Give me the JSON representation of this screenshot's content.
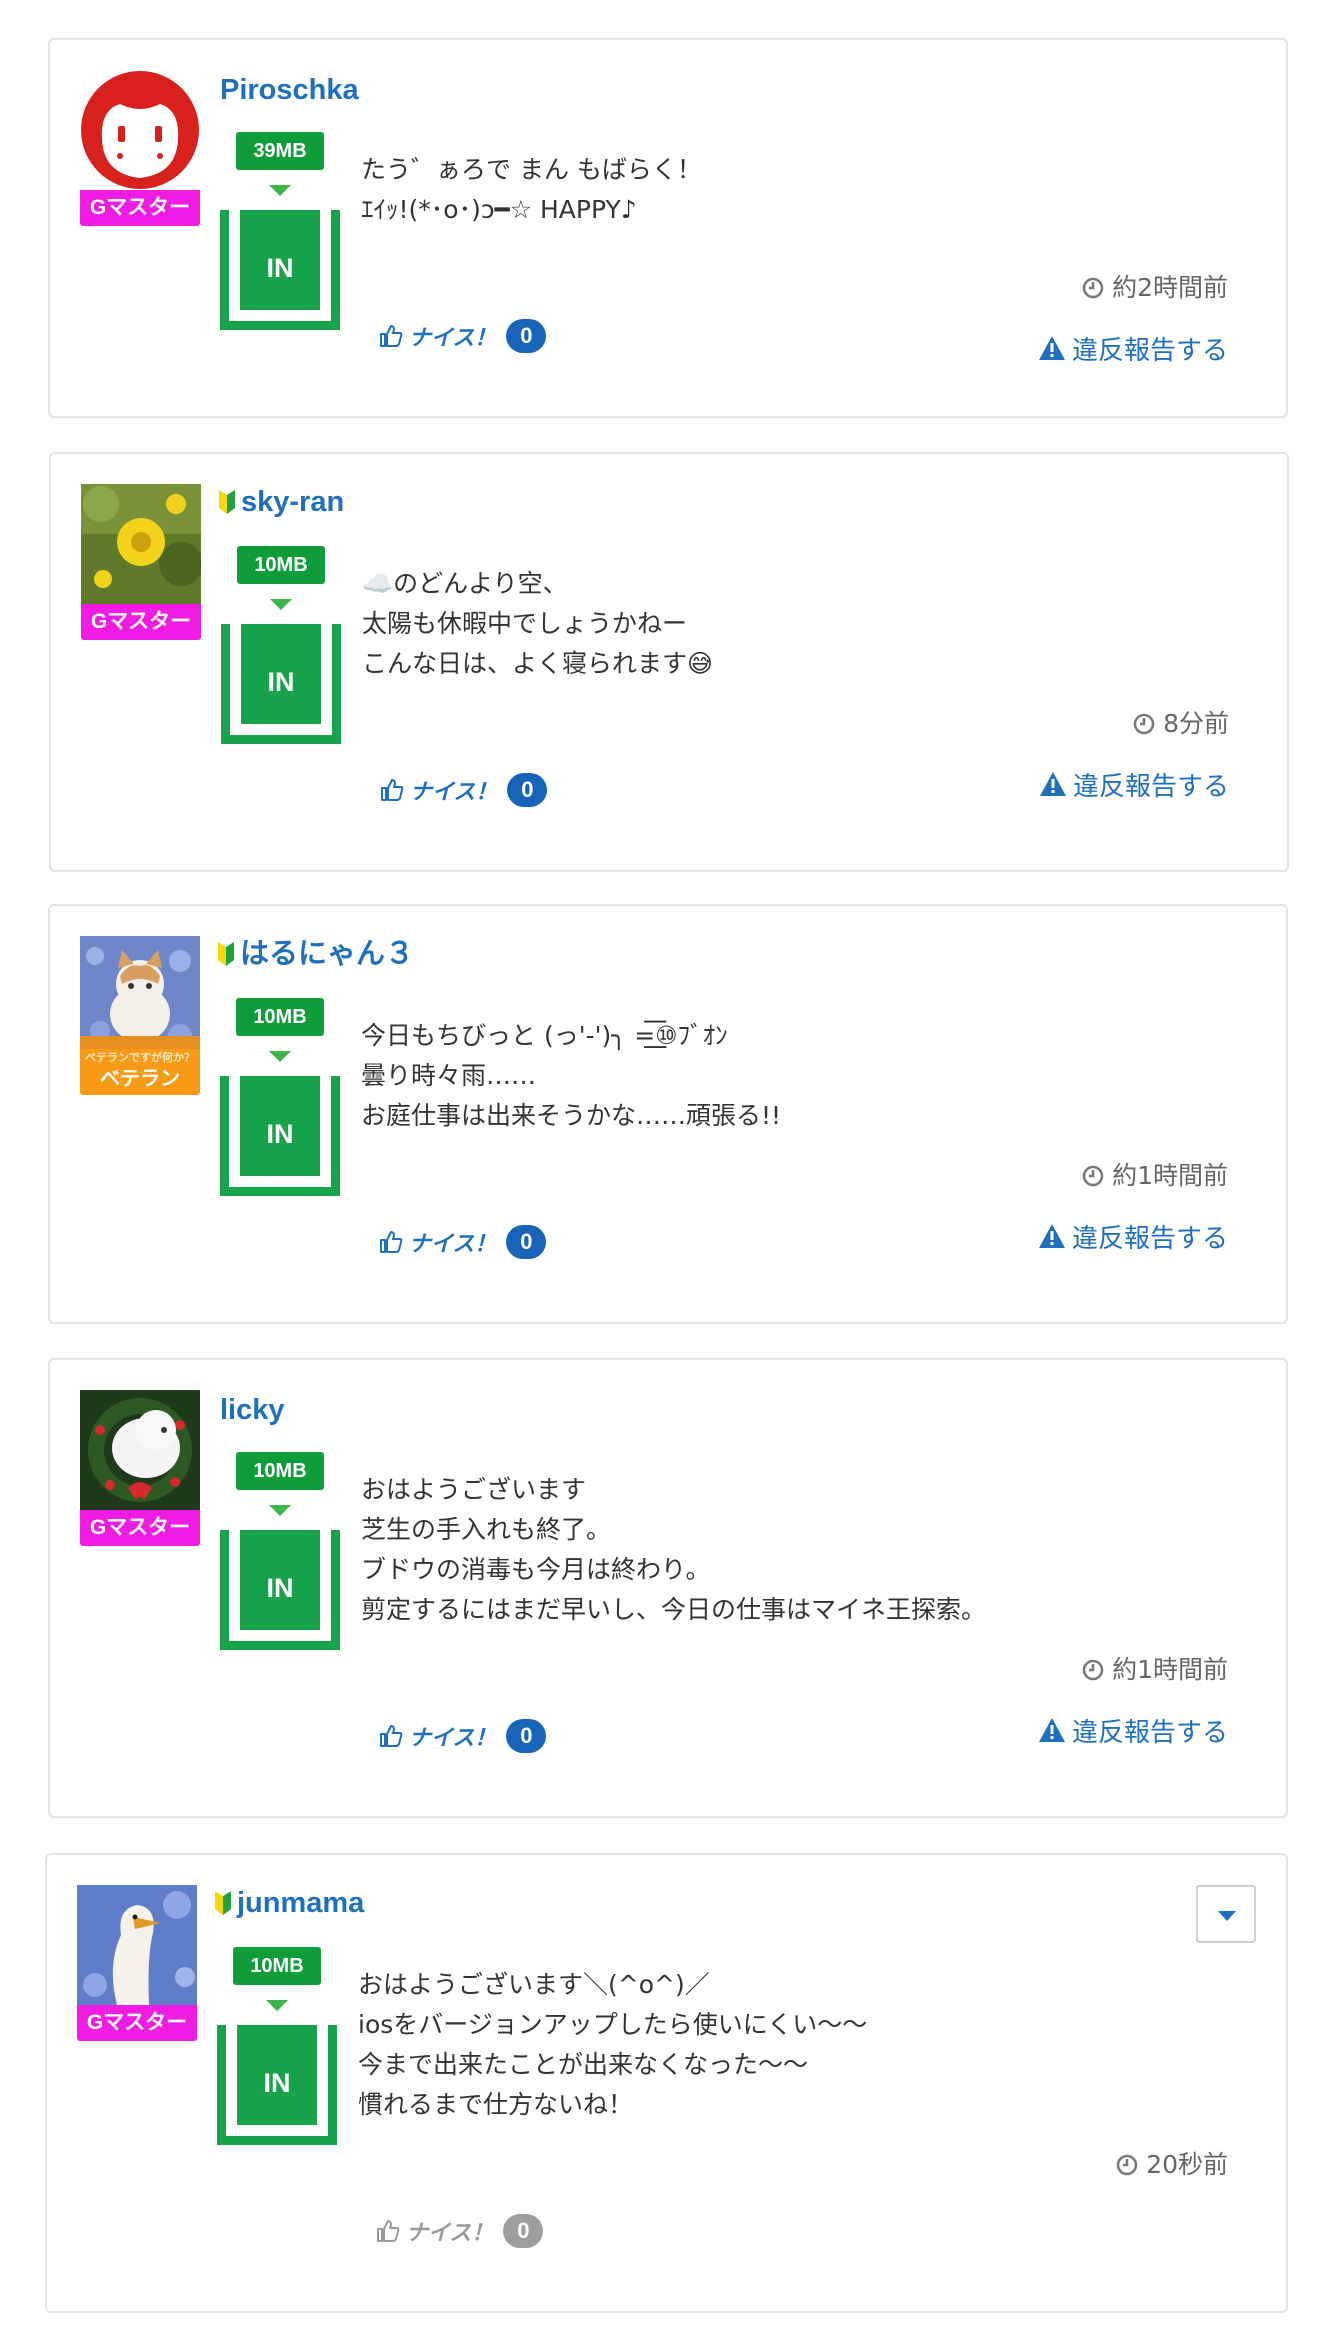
{
  "posts": [
    {
      "username": "Piroschka",
      "beginner": false,
      "rank": "Gマスター",
      "size": "39MB",
      "status": "IN",
      "message": "たう゛ぁろで まん もばらく！\nｴｲｯ!(*･o･)ɔ━☆ HAPPY♪",
      "time": "約2時間前",
      "nice_label": "ナイス！",
      "nice_count": "0",
      "report_label": "違反報告する"
    },
    {
      "username": "sky-ran",
      "beginner": true,
      "rank": "Gマスター",
      "size": "10MB",
      "status": "IN",
      "message": "☁️のどんより空、\n太陽も休暇中でしょうかねー\nこんな日は、よく寝られます😅",
      "time": "8分前",
      "nice_label": "ナイス！",
      "nice_count": "0",
      "report_label": "違反報告する"
    },
    {
      "username": "はるにゃん３",
      "beginner": true,
      "rank": "ベテラン",
      "rank_caption": "ベテランですが何か？",
      "size": "10MB",
      "status": "IN",
      "message": "今日もちびっと (っ'-')╮ =͟͟͞͞⑩ﾌﾞｵﾝ\n曇り時々雨……\nお庭仕事は出来そうかな……頑張る!!",
      "time": "約1時間前",
      "nice_label": "ナイス！",
      "nice_count": "0",
      "report_label": "違反報告する"
    },
    {
      "username": "licky",
      "beginner": false,
      "rank": "Gマスター",
      "size": "10MB",
      "status": "IN",
      "message": "おはようございます\n芝生の手入れも終了。\nブドウの消毒も今月は終わり。\n剪定するにはまだ早いし、今日の仕事はマイネ王探索。",
      "time": "約1時間前",
      "nice_label": "ナイス！",
      "nice_count": "0",
      "report_label": "違反報告する"
    },
    {
      "username": "junmama",
      "beginner": true,
      "rank": "Gマスター",
      "size": "10MB",
      "status": "IN",
      "message": "おはようございます＼(^o^)／\niosをバージョンアップしたら使いにくい〜〜\n今まで出来たことが出来なくなった〜〜\n慣れるまで仕方ないね！",
      "time": "20秒前",
      "nice_label": "ナイス！",
      "nice_count": "0"
    }
  ]
}
